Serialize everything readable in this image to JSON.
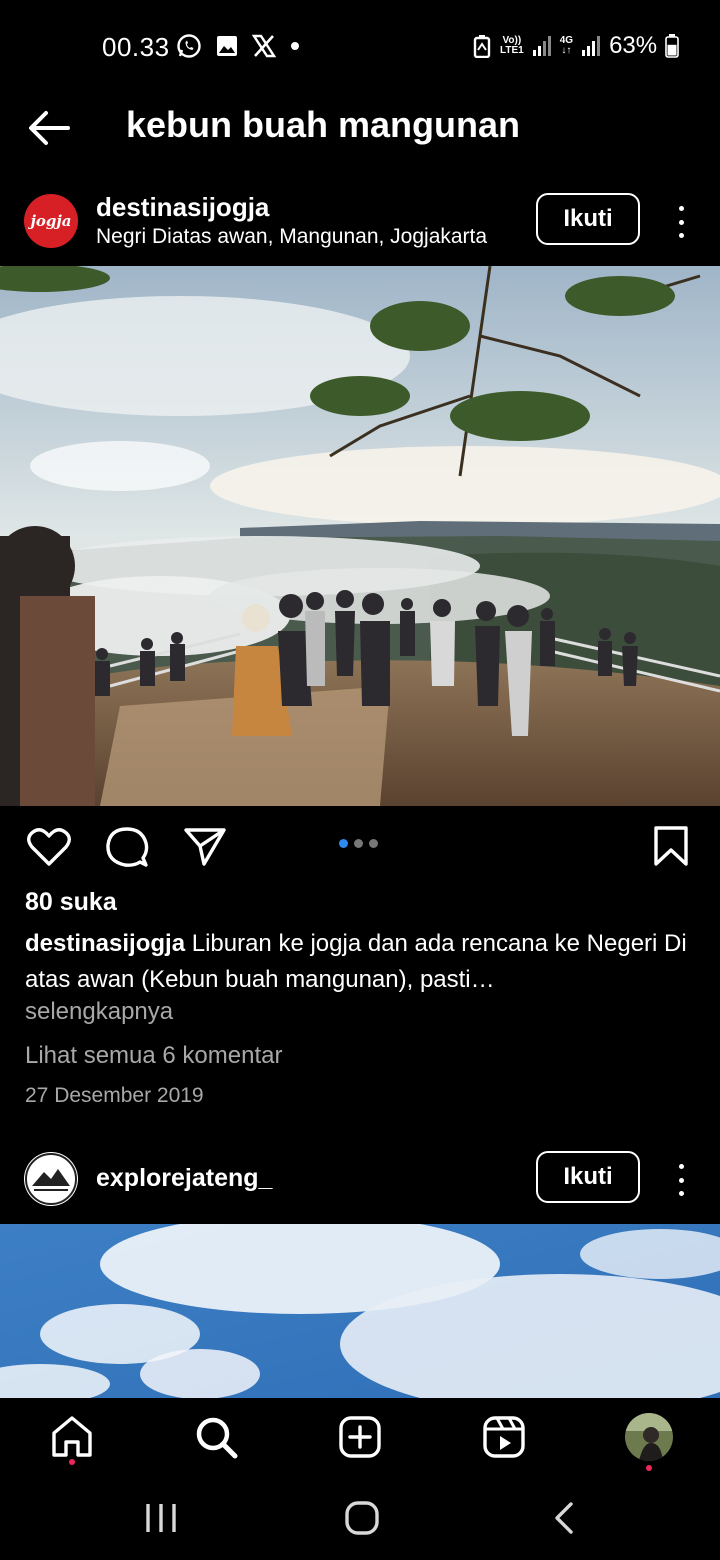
{
  "status_bar": {
    "time": "00.33",
    "network_label_top": "Vo))",
    "network_label_bottom": "LTE1",
    "network2_label": "4G",
    "battery_percent": "63%",
    "battery_level": 0.63
  },
  "header": {
    "title": "kebun buah mangunan"
  },
  "post1": {
    "avatar_text": "jogja",
    "username": "destinasijogja",
    "location": "Negri Diatas awan, Mangunan, Jogjakarta",
    "follow_label": "Ikuti",
    "carousel_total": 3,
    "carousel_active": 1,
    "likes": "80 suka",
    "caption_user": "destinasijogja",
    "caption_text": "Liburan ke jogja dan ada rencana ke Negeri Di atas awan (Kebun buah mangunan), pasti…",
    "more_label": "selengkapnya",
    "comments_label": "Lihat semua 6 komentar",
    "date": "27 Desember 2019"
  },
  "post2": {
    "username": "explorejateng_",
    "follow_label": "Ikuti"
  },
  "colors": {
    "background": "#000000",
    "text": "#ffffff",
    "muted": "#a8a8a8",
    "accent_dot": "#2e89f0",
    "notification_dot": "#f0285a",
    "avatar_brand": "#d71f26"
  },
  "icons": {
    "back": "arrow-left-icon",
    "like": "heart-icon",
    "comment": "comment-bubble-icon",
    "share": "paper-plane-icon",
    "save": "bookmark-icon",
    "nav_home": "home-icon",
    "nav_search": "search-icon",
    "nav_create": "plus-square-icon",
    "nav_reels": "reels-icon",
    "sys_recents": "recent-apps-icon",
    "sys_home": "home-circle-icon",
    "sys_back": "chevron-left-icon"
  }
}
